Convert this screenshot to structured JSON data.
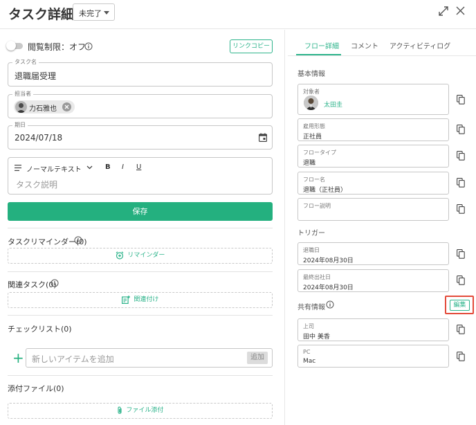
{
  "header": {
    "title": "タスク詳細",
    "status": "未完了"
  },
  "left": {
    "restriction_label": "閲覧制限：オフ",
    "link_copy": "リンクコピー",
    "task_name": {
      "label": "タスク名",
      "value": "退職届受理"
    },
    "assignee": {
      "label": "担当者",
      "name": "力石雅也"
    },
    "due": {
      "label": "期日",
      "value": "2024/07/18"
    },
    "editor": {
      "format": "ノーマルテキスト",
      "bold": "B",
      "italic": "I",
      "underline": "U",
      "placeholder": "タスク説明"
    },
    "save_label": "保存",
    "reminder": {
      "label": "タスクリマインダー(0)",
      "button": "リマインダー"
    },
    "related": {
      "label": "関連タスク(0)",
      "button": "関連付け"
    },
    "checklist": {
      "label": "チェックリスト(0)",
      "placeholder": "新しいアイテムを追加",
      "add": "追加"
    },
    "attachments": {
      "label": "添付ファイル(0)",
      "button": "ファイル添付"
    }
  },
  "right": {
    "tabs": [
      {
        "label": "フロー詳細",
        "active": true
      },
      {
        "label": "コメント",
        "active": false
      },
      {
        "label": "アクティビティログ",
        "active": false
      }
    ],
    "basic_info": {
      "heading": "基本情報",
      "fields": [
        {
          "label": "対象者",
          "value": "太田圭"
        },
        {
          "label": "雇用形態",
          "value": "正社員"
        },
        {
          "label": "フロータイプ",
          "value": "退職"
        },
        {
          "label": "フロー名",
          "value": "退職（正社員）"
        },
        {
          "label": "フロー説明",
          "value": ""
        }
      ]
    },
    "trigger": {
      "heading": "トリガー",
      "fields": [
        {
          "label": "退職日",
          "value": "2024年08月30日"
        },
        {
          "label": "最終出社日",
          "value": "2024年08月30日"
        }
      ]
    },
    "shared": {
      "heading": "共有情報",
      "edit_label": "編集",
      "fields": [
        {
          "label": "上司",
          "value": "田中 美香"
        },
        {
          "label": "PC",
          "value": "Mac"
        }
      ]
    }
  },
  "colors": {
    "accent": "#24b07f",
    "highlight": "#e34a3a"
  }
}
